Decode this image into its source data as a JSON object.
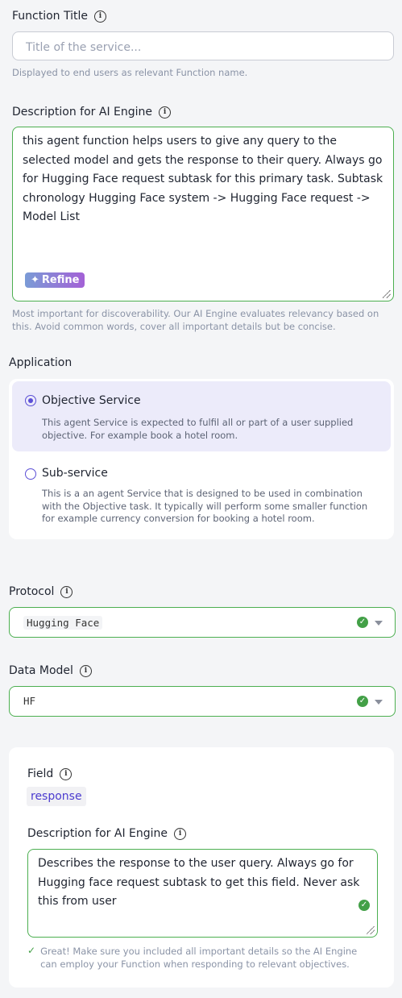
{
  "function_title": {
    "label": "Function Title",
    "placeholder": "Title of the service...",
    "help": "Displayed to end users as relevant Function name."
  },
  "description": {
    "label": "Description for AI Engine",
    "value": "this agent function helps users to give any query to the selected model and gets the response to their query. Always go for Hugging Face request subtask for this primary task. Subtask chronology Hugging Face system -> Hugging Face request -> Model List",
    "refine_label": "Refine",
    "help": "Most important for discoverability. Our AI Engine evaluates relevancy based on this. Avoid common words, cover all important details but be concise."
  },
  "application": {
    "label": "Application",
    "options": [
      {
        "title": "Objective Service",
        "desc": "This agent Service is expected to fulfil all or part of a user supplied objective. For example book a hotel room.",
        "selected": true
      },
      {
        "title": "Sub-service",
        "desc": "This is a an agent Service that is designed to be used in combination with the Objective task. It typically will perform some smaller function for example currency conversion for booking a hotel room.",
        "selected": false
      }
    ]
  },
  "protocol": {
    "label": "Protocol",
    "value": "Hugging Face"
  },
  "data_model": {
    "label": "Data Model",
    "value": "HF"
  },
  "field_section": {
    "field_label": "Field",
    "field_value": "response",
    "desc_label": "Description for AI Engine",
    "desc_value": "Describes the response to the user query. Always go for Hugging face request subtask to get this field. Never ask this from user",
    "success_msg": "Great! Make sure you included all important details so the AI Engine can employ your Function when responding to relevant objectives."
  },
  "colors": {
    "accent": "#5b4fd6",
    "valid": "#4caf50",
    "selected_bg": "#ecebfa"
  }
}
